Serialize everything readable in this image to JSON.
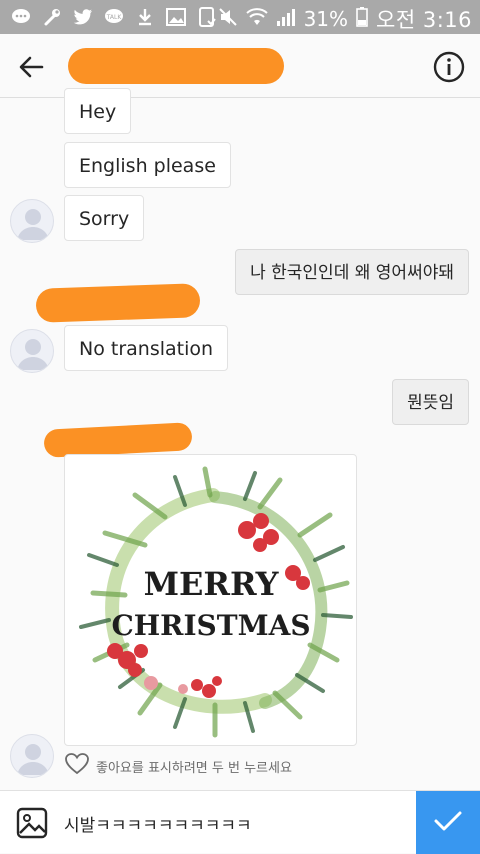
{
  "status_bar": {
    "battery": "31%",
    "time": "오전 3:16",
    "icons": [
      "chat-bubble-icon",
      "wrench-icon",
      "twitter-icon",
      "talk-icon",
      "download-icon",
      "image-icon",
      "screenshot-icon",
      "mute-icon",
      "wifi-icon",
      "signal-icon",
      "battery-icon"
    ]
  },
  "header": {
    "back_icon": "arrow-left-icon",
    "info_icon": "info-icon"
  },
  "messages": [
    {
      "side": "them",
      "text": "Hey"
    },
    {
      "side": "them",
      "text": "English please"
    },
    {
      "side": "them",
      "text": "Sorry"
    },
    {
      "side": "me",
      "text": "나 한국인인데 왜 영어써야돼"
    },
    {
      "side": "them",
      "text": "No translation"
    },
    {
      "side": "me",
      "text": "뭔뜻임"
    }
  ],
  "photo": {
    "lines": [
      "MERRY",
      "CHRISTMAS"
    ]
  },
  "like_hint": "좋아요를 표시하려면 두 번 누르세요",
  "composer": {
    "value": "시발ㅋㅋㅋㅋㅋㅋㅋㅋㅋㅋ"
  },
  "colors": {
    "accent": "#3897f0",
    "redaction": "#fb9124",
    "status_bar": "#a9a9a9"
  }
}
